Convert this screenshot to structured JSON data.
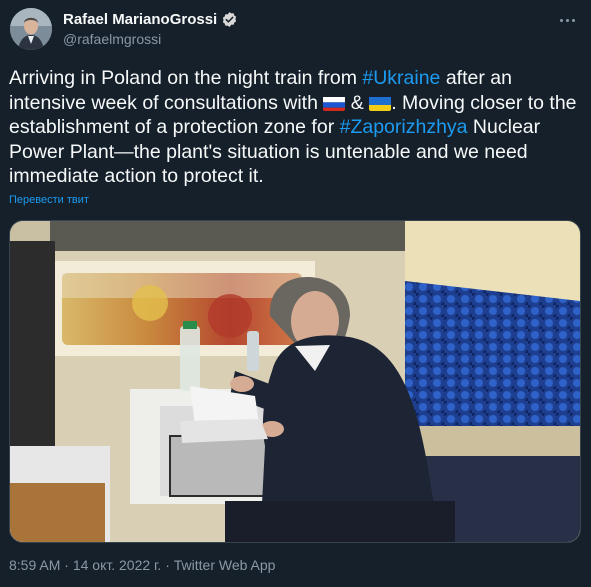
{
  "author": {
    "name": "Rafael MarianoGrossi",
    "handle": "@rafaelmgrossi",
    "verified": true
  },
  "tweet": {
    "part1": "Arriving in Poland on the night train from ",
    "hashtag1": "#Ukraine",
    "part2": " after an intensive week of consultations with ",
    "amp": " & ",
    "part3": ". Moving closer to the establishment of a protection zone for ",
    "hashtag2": "#Zaporizhzhya",
    "part4": " Nuclear Power Plant—the plant's situation is untenable and we need immediate action to protect it.",
    "flags": [
      "russia-flag",
      "ukraine-flag"
    ]
  },
  "translate_label": "Перевести твит",
  "meta": {
    "time": "8:59 AM",
    "separator1": " · ",
    "date": "14 окт. 2022 г.",
    "separator2": " · ",
    "app": "Twitter Web App"
  },
  "colors": {
    "background": "#15202b",
    "text": "#f7f9f9",
    "secondary": "#8b98a5",
    "link": "#1d9bf0",
    "verified": "#d9d9d9"
  }
}
